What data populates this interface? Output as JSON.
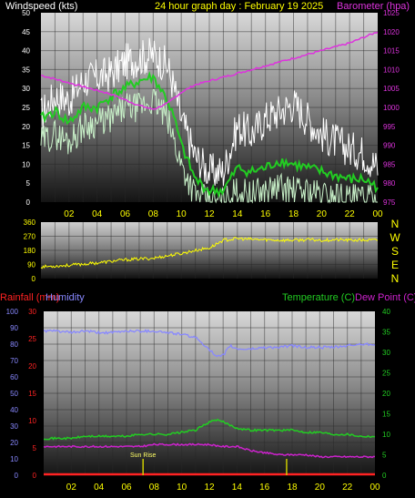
{
  "title": "24 hour graph day : February 19 2025",
  "colors": {
    "background": "#000000",
    "wind_max": "#ffffff",
    "wind_avg": "#22cc22",
    "wind_min": "#c8f0c8",
    "barometer": "#dd33dd",
    "direction": "#ffff00",
    "rainfall": "#ff2222",
    "humidity": "#8888ff",
    "temperature": "#22cc22",
    "dew_point": "#cc22cc",
    "axis_yellow": "#ffff00",
    "sunrise_mark": "#cccc00"
  },
  "chart_data": [
    {
      "id": "wind_baro",
      "type": "line",
      "title": "24 hour graph day : February 19 2025",
      "ylabel_left": "Windspeed (kts)",
      "ylabel_right": "Barometer (hpa)",
      "x_ticks": [
        "02",
        "04",
        "06",
        "08",
        "10",
        "12",
        "14",
        "16",
        "18",
        "20",
        "22",
        "00"
      ],
      "x_range": [
        0,
        24
      ],
      "ylim_left": [
        0,
        50
      ],
      "yticks_left": [
        "0",
        "5",
        "10",
        "15",
        "20",
        "25",
        "30",
        "35",
        "40",
        "45",
        "50"
      ],
      "ylim_right": [
        975,
        1025
      ],
      "yticks_right": [
        "975",
        "980",
        "985",
        "990",
        "995",
        "1000",
        "1005",
        "1010",
        "1015",
        "1020",
        "1025"
      ],
      "grid": true,
      "series": [
        {
          "key": "wind_max",
          "axis": "left",
          "x": [
            0,
            1,
            2,
            3,
            4,
            5,
            6,
            7,
            8,
            9,
            9.5,
            10,
            11,
            12,
            13,
            14,
            15,
            16,
            17,
            18,
            19,
            20,
            21,
            22,
            23,
            24
          ],
          "y": [
            23,
            28,
            27,
            32,
            33,
            34,
            37,
            38,
            39,
            36,
            30,
            22,
            12,
            8,
            8,
            20,
            18,
            22,
            24,
            26,
            22,
            18,
            16,
            14,
            13,
            9
          ]
        },
        {
          "key": "wind_avg",
          "axis": "left",
          "x": [
            0,
            1,
            2,
            3,
            4,
            5,
            6,
            7,
            8,
            9,
            9.5,
            10,
            11,
            12,
            13,
            14,
            15,
            16,
            17,
            18,
            19,
            20,
            21,
            22,
            23,
            24
          ],
          "y": [
            22,
            24,
            21,
            25,
            25,
            28,
            30,
            32,
            33,
            27,
            22,
            15,
            6,
            3,
            3,
            9,
            8,
            9,
            11,
            10,
            9,
            8,
            7,
            6,
            6,
            4
          ]
        },
        {
          "key": "wind_min",
          "axis": "left",
          "x": [
            0,
            1,
            2,
            3,
            4,
            5,
            6,
            7,
            8,
            9,
            9.5,
            10,
            11,
            12,
            13,
            14,
            15,
            16,
            17,
            18,
            19,
            20,
            21,
            22,
            23,
            24
          ],
          "y": [
            16,
            18,
            16,
            20,
            21,
            22,
            25,
            25,
            27,
            22,
            16,
            10,
            2,
            0,
            0,
            3,
            2,
            3,
            4,
            3,
            3,
            2,
            2,
            1,
            1,
            0
          ]
        },
        {
          "key": "barometer",
          "axis": "right",
          "x": [
            0,
            1,
            2,
            3,
            4,
            5,
            6,
            7,
            8,
            9,
            10,
            11,
            12,
            13,
            14,
            15,
            16,
            17,
            18,
            19,
            20,
            21,
            22,
            23,
            24
          ],
          "y": [
            1008.5,
            1007.5,
            1006.5,
            1005.5,
            1004.5,
            1003.5,
            1002,
            1000.5,
            999.5,
            1001,
            1004,
            1006,
            1007,
            1008,
            1009,
            1010,
            1011,
            1012,
            1013,
            1014,
            1015,
            1016,
            1017,
            1018.5,
            1020
          ]
        }
      ]
    },
    {
      "id": "direction",
      "type": "line",
      "x_range": [
        0,
        24
      ],
      "ylim": [
        0,
        360
      ],
      "yticks": [
        "0",
        "90",
        "180",
        "270",
        "360"
      ],
      "compass": [
        "N",
        "W",
        "S",
        "E",
        "N"
      ],
      "grid": true,
      "series": [
        {
          "key": "direction",
          "x": [
            0,
            1,
            2,
            3,
            4,
            5,
            6,
            7,
            8,
            9,
            10,
            11,
            12,
            13,
            14,
            15,
            16,
            17,
            18,
            19,
            20,
            21,
            22,
            23,
            24
          ],
          "y": [
            75,
            80,
            85,
            92,
            100,
            110,
            120,
            125,
            130,
            145,
            160,
            180,
            195,
            245,
            255,
            250,
            248,
            245,
            245,
            248,
            245,
            248,
            245,
            245,
            245
          ]
        }
      ]
    },
    {
      "id": "rain_hum_temp",
      "type": "line",
      "ylabel_left_1": "Rainfall (mm)",
      "ylabel_left_2": "Humidity",
      "ylabel_right_1": "Temperature (C)",
      "ylabel_right_2": "Dew Point (C)",
      "x_ticks": [
        "02",
        "04",
        "06",
        "08",
        "10",
        "12",
        "14",
        "16",
        "18",
        "20",
        "22",
        "00"
      ],
      "x_range": [
        0,
        24
      ],
      "ylim_humidity": [
        0,
        100
      ],
      "yticks_humidity": [
        "0",
        "10",
        "20",
        "30",
        "40",
        "50",
        "60",
        "70",
        "80",
        "90",
        "100"
      ],
      "ylim_rain": [
        0,
        30
      ],
      "yticks_rain": [
        "0",
        "5",
        "10",
        "15",
        "20",
        "25",
        "30"
      ],
      "ylim_temp": [
        0,
        40
      ],
      "yticks_temp": [
        "0",
        "5",
        "10",
        "15",
        "20",
        "25",
        "30",
        "35",
        "40"
      ],
      "annotation": "Sun Rise",
      "grid": true,
      "series": [
        {
          "key": "humidity",
          "axis": "humidity",
          "x": [
            0,
            1,
            2,
            3,
            4,
            5,
            6,
            7,
            8,
            9,
            10,
            11,
            12,
            12.5,
            13,
            13.5,
            14,
            15,
            16,
            17,
            18,
            19,
            20,
            21,
            22,
            23,
            24
          ],
          "y": [
            88,
            88,
            87,
            88,
            87,
            87,
            88,
            88,
            88,
            87,
            86,
            84,
            77,
            72,
            73,
            79,
            77,
            77,
            78,
            78,
            79,
            78,
            78,
            78,
            79,
            80,
            80
          ]
        },
        {
          "key": "rainfall",
          "axis": "rain",
          "x": [
            0,
            24
          ],
          "y": [
            0,
            0
          ]
        },
        {
          "key": "temperature",
          "axis": "temp",
          "x": [
            0,
            1,
            2,
            3,
            4,
            5,
            6,
            7,
            8,
            9,
            10,
            11,
            12,
            12.5,
            13,
            14,
            15,
            16,
            17,
            18,
            19,
            20,
            21,
            22,
            23,
            24
          ],
          "y": [
            9,
            9,
            9,
            9.5,
            9.5,
            9.5,
            9.5,
            10,
            10,
            10,
            10.5,
            11,
            13,
            13.5,
            13,
            11.5,
            11,
            11,
            11,
            11,
            10.5,
            10.5,
            10,
            10,
            9.5,
            9.5
          ]
        },
        {
          "key": "dew_point",
          "axis": "temp",
          "x": [
            0,
            1,
            2,
            3,
            4,
            5,
            6,
            7,
            8,
            9,
            10,
            11,
            12,
            13,
            14,
            15,
            16,
            17,
            18,
            19,
            20,
            21,
            22,
            23,
            24
          ],
          "y": [
            7,
            7,
            7,
            7,
            7,
            7,
            7,
            7,
            7.5,
            7.5,
            7.5,
            7.5,
            7.5,
            7,
            7,
            6,
            5.5,
            5,
            5,
            5,
            4.5,
            4.5,
            4.5,
            4.5,
            4.5
          ]
        }
      ],
      "markers": [
        {
          "key": "sunrise",
          "x": 7.2,
          "label": "Sun Rise"
        },
        {
          "key": "sunset",
          "x": 17.6,
          "label": ""
        }
      ]
    }
  ]
}
